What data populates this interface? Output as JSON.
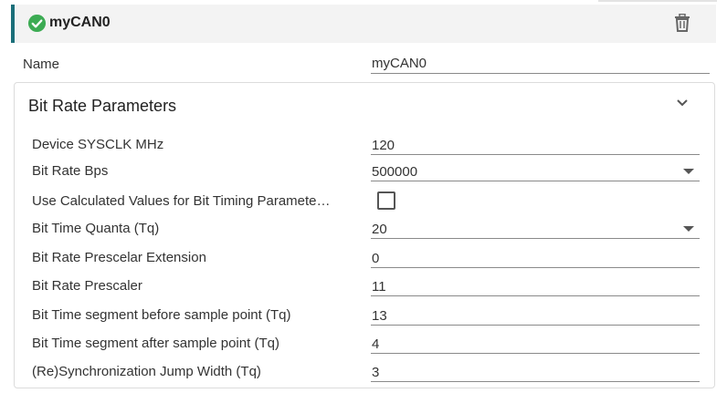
{
  "module": {
    "name": "myCAN0",
    "status_icon": "check-circle-icon",
    "delete_icon": "trash-icon",
    "accent_color": "#1b6f7a",
    "status_color": "#3cab53"
  },
  "name_row": {
    "label": "Name",
    "value": "myCAN0"
  },
  "panel": {
    "title": "Bit Rate Parameters",
    "collapse_icon": "chevron-down-icon",
    "params": [
      {
        "label": "Device SYSCLK MHz",
        "value": "120",
        "type": "text"
      },
      {
        "label": "Bit Rate Bps",
        "value": "500000",
        "type": "select"
      },
      {
        "label": "Use Calculated Values for Bit Timing Paramete…",
        "value": false,
        "type": "checkbox"
      },
      {
        "label": "Bit Time Quanta (Tq)",
        "value": "20",
        "type": "select"
      },
      {
        "label": "Bit Rate Prescelar Extension",
        "value": "0",
        "type": "text"
      },
      {
        "label": "Bit Rate Prescaler",
        "value": "11",
        "type": "text"
      },
      {
        "label": "Bit Time segment before sample point (Tq)",
        "value": "13",
        "type": "text"
      },
      {
        "label": "Bit Time segment after sample point (Tq)",
        "value": "4",
        "type": "text"
      },
      {
        "label": "(Re)Synchronization Jump Width (Tq)",
        "value": "3",
        "type": "text"
      }
    ]
  }
}
